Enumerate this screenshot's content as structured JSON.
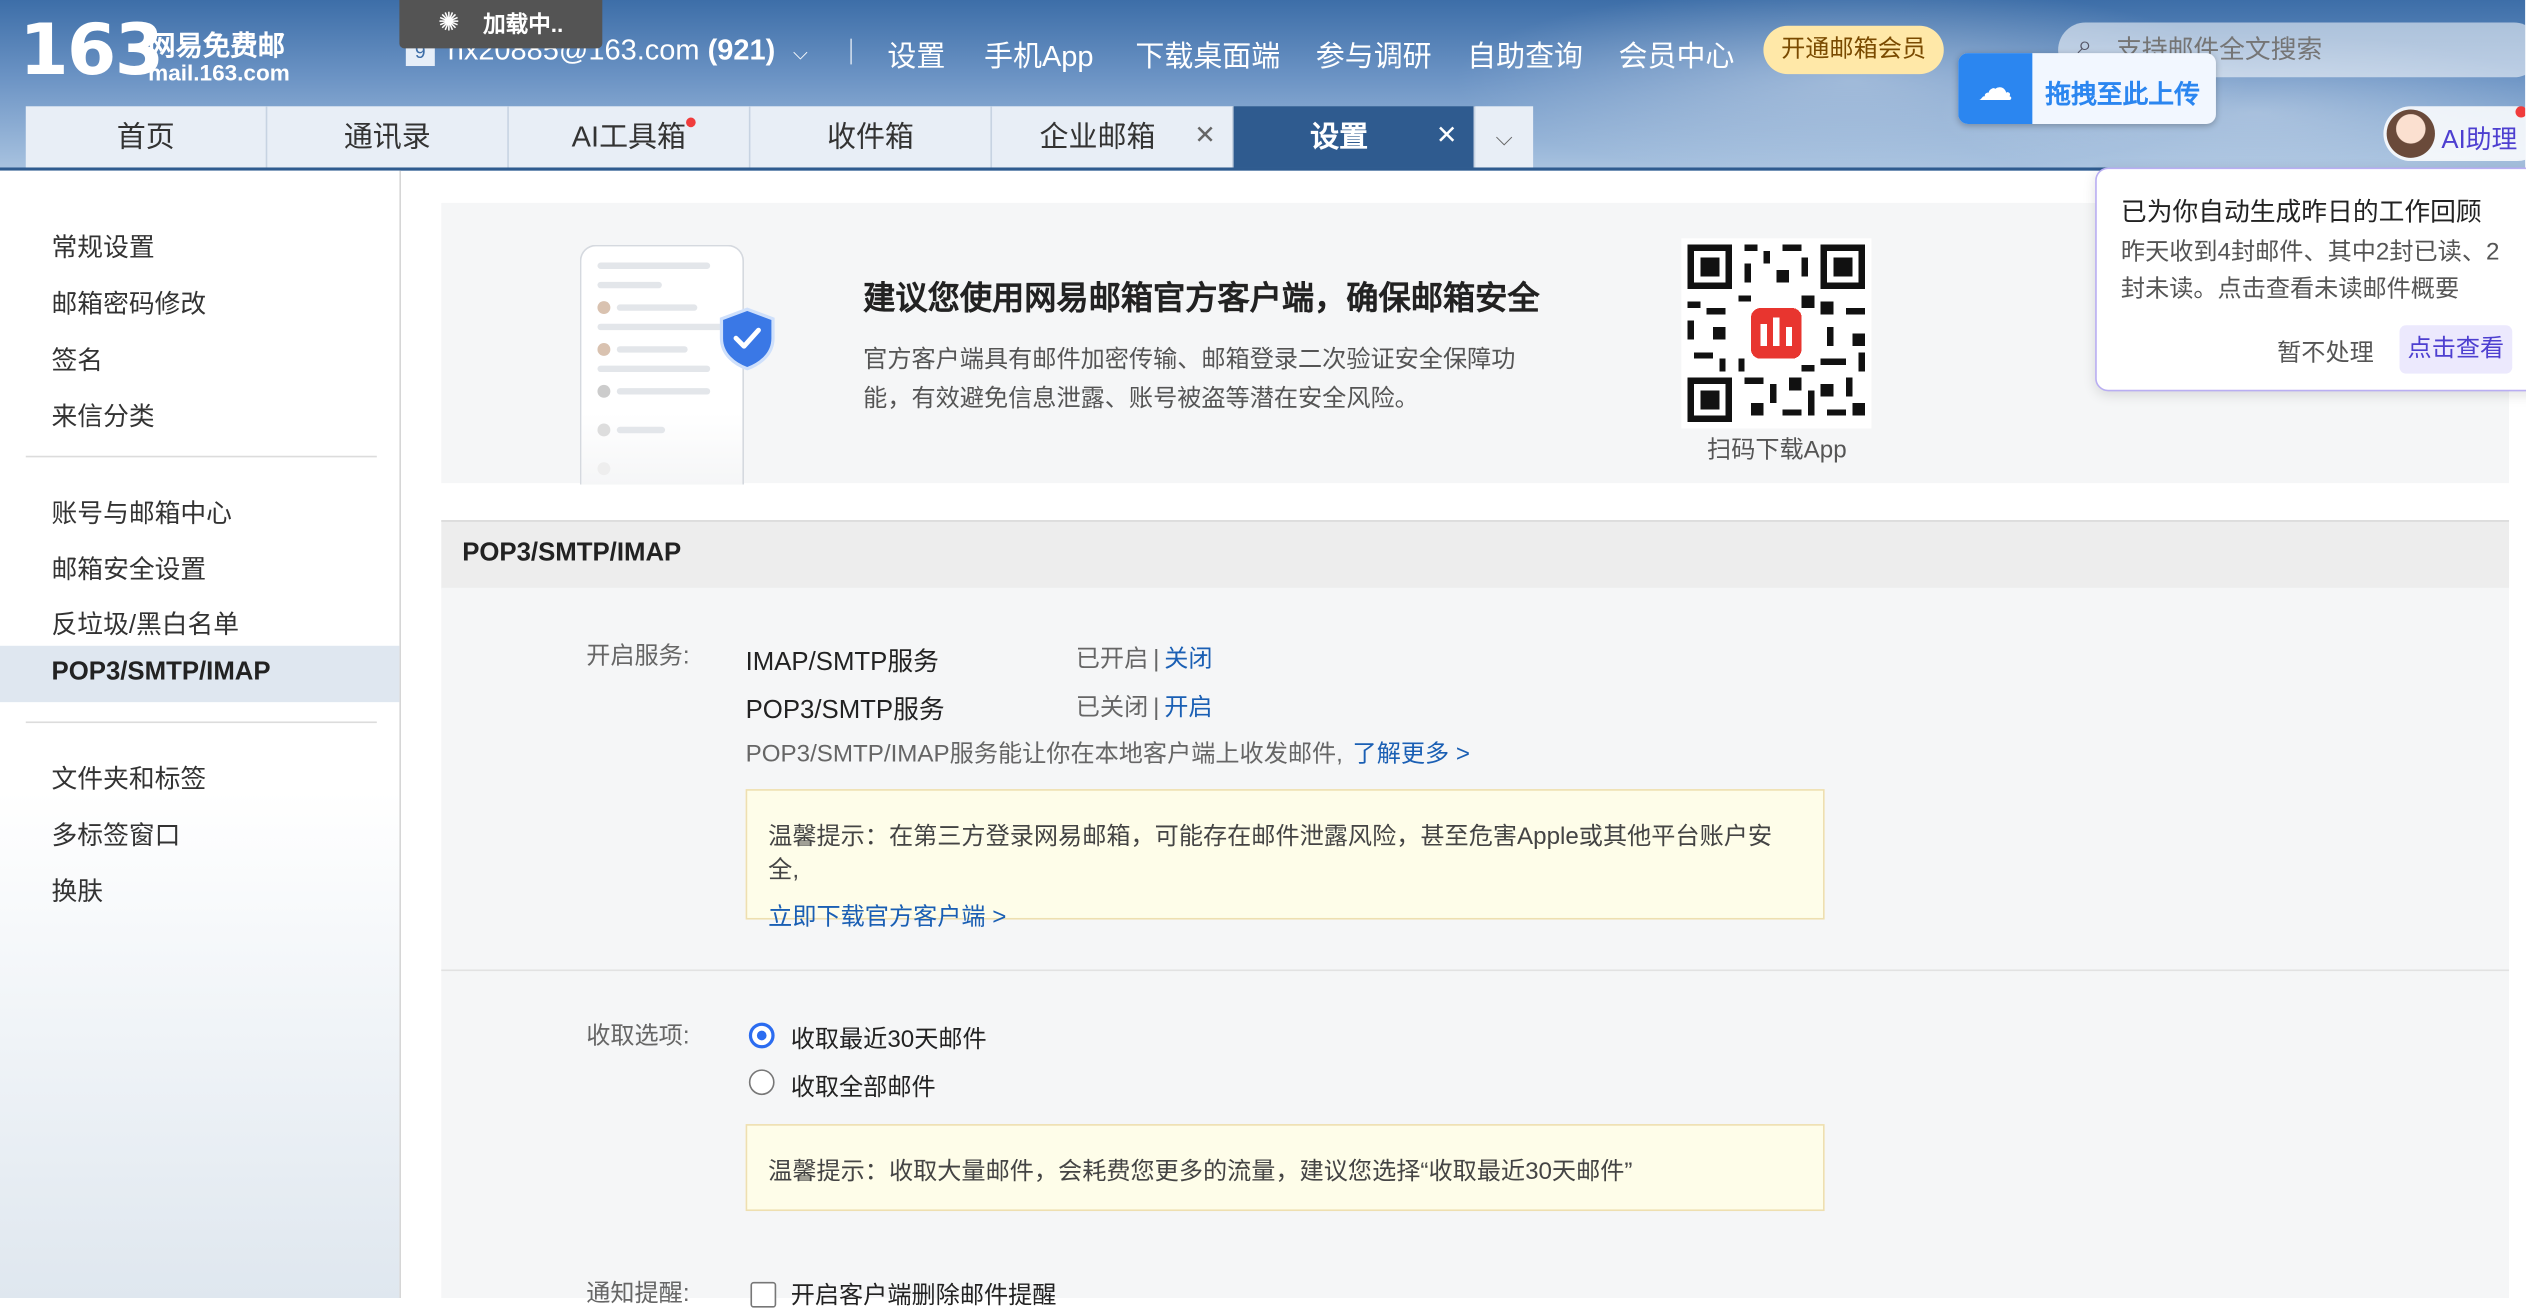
{
  "brand": {
    "number": "163",
    "name_cn": "网易免费邮",
    "domain": "mail.163.com"
  },
  "loading_text": "加载中..",
  "account": {
    "email": "hx20885@163.com",
    "unread": "(921)"
  },
  "top_nav": [
    "设置",
    "手机App",
    "下载桌面端",
    "参与调研",
    "自助查询",
    "会员中心"
  ],
  "vip_button": "开通邮箱会员",
  "search": {
    "placeholder": "支持邮件全文搜索"
  },
  "upload": {
    "label": "拖拽至此上传"
  },
  "tabs": [
    {
      "label": "首页"
    },
    {
      "label": "通讯录"
    },
    {
      "label": "AI工具箱"
    },
    {
      "label": "收件箱"
    },
    {
      "label": "企业邮箱"
    },
    {
      "label": "设置"
    }
  ],
  "ai_helper": {
    "label": "AI助理"
  },
  "popup": {
    "title": "已为你自动生成昨日的工作回顾",
    "body": "昨天收到4封邮件、其中2封已读、2封未读。点击查看未读邮件概要",
    "ignore": "暂不处理",
    "view": "点击查看"
  },
  "sidebar": {
    "group1": [
      "常规设置",
      "邮箱密码修改",
      "签名",
      "来信分类"
    ],
    "group2": [
      "账号与邮箱中心",
      "邮箱安全设置",
      "反垃圾/黑白名单",
      "POP3/SMTP/IMAP"
    ],
    "group3": [
      "文件夹和标签",
      "多标签窗口",
      "换肤"
    ]
  },
  "banner": {
    "title": "建议您使用网易邮箱官方客户端，确保邮箱安全",
    "desc": "官方客户端具有邮件加密传输、邮箱登录二次验证安全保障功能，有效避免信息泄露、账号被盗等潜在安全风险。",
    "qr_label": "扫码下载App"
  },
  "section": {
    "title": "POP3/SMTP/IMAP",
    "service_label": "开启服务:",
    "services": [
      {
        "name": "IMAP/SMTP服务",
        "state": "已开启",
        "sep": "|",
        "action": "关闭"
      },
      {
        "name": "POP3/SMTP服务",
        "state": "已关闭",
        "sep": "|",
        "action": "开启"
      }
    ],
    "note": "POP3/SMTP/IMAP服务能让你在本地客户端上收发邮件,",
    "learn_more": "了解更多 >",
    "tip1": "温馨提示：在第三方登录网易邮箱，可能存在邮件泄露风险，甚至危害Apple或其他平台账户安全,",
    "tip1_link": "立即下载官方客户端 >",
    "receive_label": "收取选项:",
    "receive_options": [
      "收取最近30天邮件",
      "收取全部邮件"
    ],
    "receive_selected": "收取最近30天邮件",
    "tip2": "温馨提示：收取大量邮件，会耗费您更多的流量，建议您选择“收取最近30天邮件”",
    "notify_label": "通知提醒:",
    "notify_option": "开启客户端删除邮件提醒"
  },
  "colors": {
    "accent": "#2f5b8f",
    "link": "#1a5fb4",
    "ai": "#4d3fd0",
    "upload": "#2b86f0"
  }
}
